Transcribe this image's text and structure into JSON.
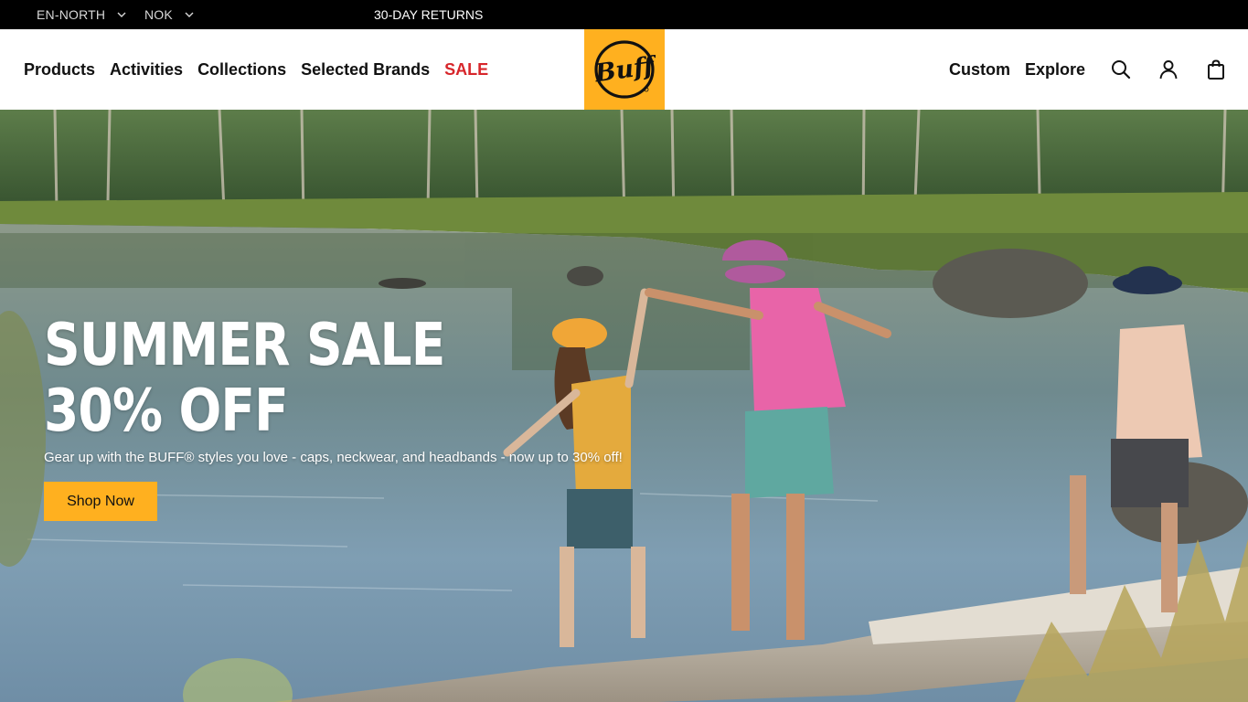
{
  "topbar": {
    "region": "EN-NORTH",
    "currency": "NOK",
    "promo": "30-DAY RETURNS"
  },
  "nav": {
    "left_links": [
      "Products",
      "Activities",
      "Collections",
      "Selected Brands",
      "SALE"
    ],
    "right_links": [
      "Custom",
      "Explore"
    ],
    "logo_text": "Buff"
  },
  "hero": {
    "title_line1": "SUMMER SALE",
    "title_line2": "30% OFF",
    "subtitle": "Gear up with the BUFF® styles you love - caps, neckwear, and headbands - now up to 30% off!",
    "cta": "Shop Now"
  },
  "colors": {
    "brand": "#ffb01f",
    "sale": "#d7262b",
    "topbar": "#000000"
  },
  "icons": [
    "chevron-down-icon",
    "search-icon",
    "account-icon",
    "shopping-bag-icon",
    "buff-logo"
  ]
}
